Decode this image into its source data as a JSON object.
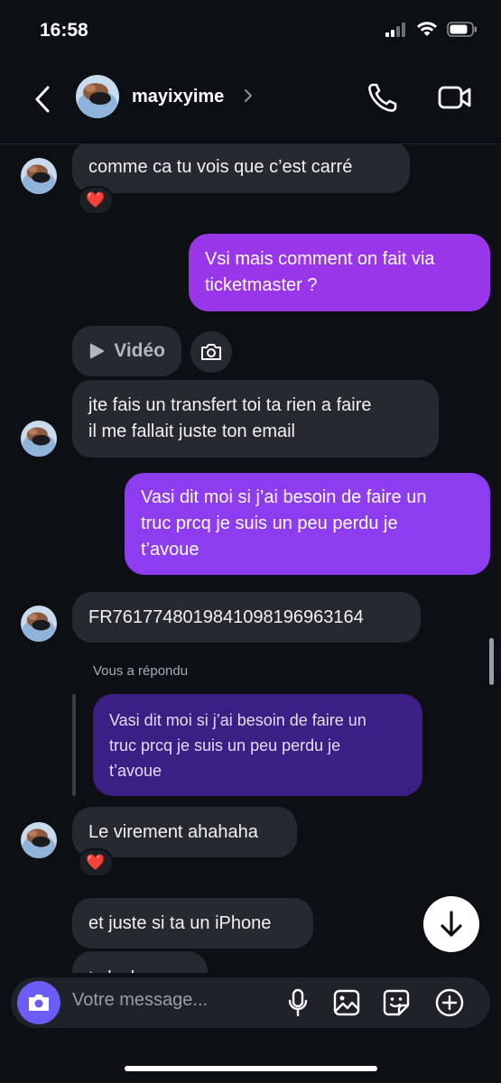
{
  "status": {
    "time": "16:58"
  },
  "header": {
    "contact_name": "mayixyime"
  },
  "messages": {
    "m1": "comme ca tu vois que c’est carré",
    "m1_reaction": "❤️",
    "m2_line1": "Vsi mais comment on fait via",
    "m2_line2": "ticketmaster ?",
    "video_label": "Vidéo",
    "m3_line1": "jte fais un transfert toi ta rien a faire",
    "m3_line2": "il me fallait juste ton email",
    "m4_line1": "Vasi dit moi si j’ai besoin de faire un",
    "m4_line2": "truc prcq je suis un peu perdu je",
    "m4_line3": "t’avoue",
    "m5": "FR7617748019841098196963164",
    "reply_label": "Vous a répondu",
    "quote_line1": "Vasi dit moi si j’ai besoin de faire un",
    "quote_line2": "truc prcq je suis un peu perdu je",
    "quote_line3": "t’avoue",
    "m6": "Le virement ahahaha",
    "m6_reaction": "❤️",
    "m7": "et juste si ta un iPhone",
    "m8_partial": "t sk sk"
  },
  "composer": {
    "placeholder": "Votre message..."
  },
  "colors": {
    "background": "#0c0f14",
    "incoming_bubble": "#262a30",
    "outgoing_purple": "#9a36ea",
    "outgoing_violet": "#8d3cf0",
    "quoted_bubble": "#3b1f84",
    "camera_button": "#6b5cf5"
  },
  "icons": [
    "signal-icon",
    "wifi-icon",
    "battery-icon",
    "back-arrow-icon",
    "chevron-right-icon",
    "phone-icon",
    "video-camera-icon",
    "play-icon",
    "camera-icon",
    "arrow-down-icon",
    "microphone-icon",
    "gallery-icon",
    "sticker-icon",
    "plus-icon"
  ]
}
